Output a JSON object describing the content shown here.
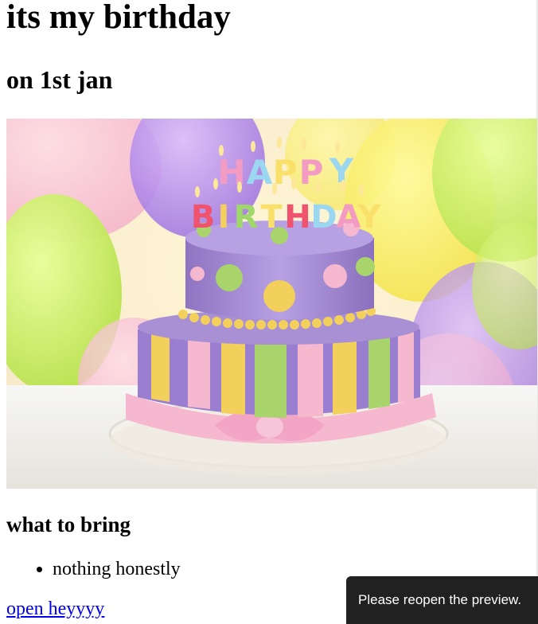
{
  "heading": "its my birthday",
  "subheading": "on 1st jan",
  "image": {
    "cake_topper_line1": "HAPPY",
    "cake_topper_line2": "BIRTHDAY",
    "colors": {
      "cake_top": "#a98fd3",
      "ribbon_pink": "#f6b8cf",
      "stripe_yellow": "#f3cf5b",
      "stripe_green": "#a9d36b"
    }
  },
  "section_title": "what to bring",
  "list": [
    "nothing honestly"
  ],
  "link_text": "open heyyyy",
  "toast": "Please reopen the preview."
}
